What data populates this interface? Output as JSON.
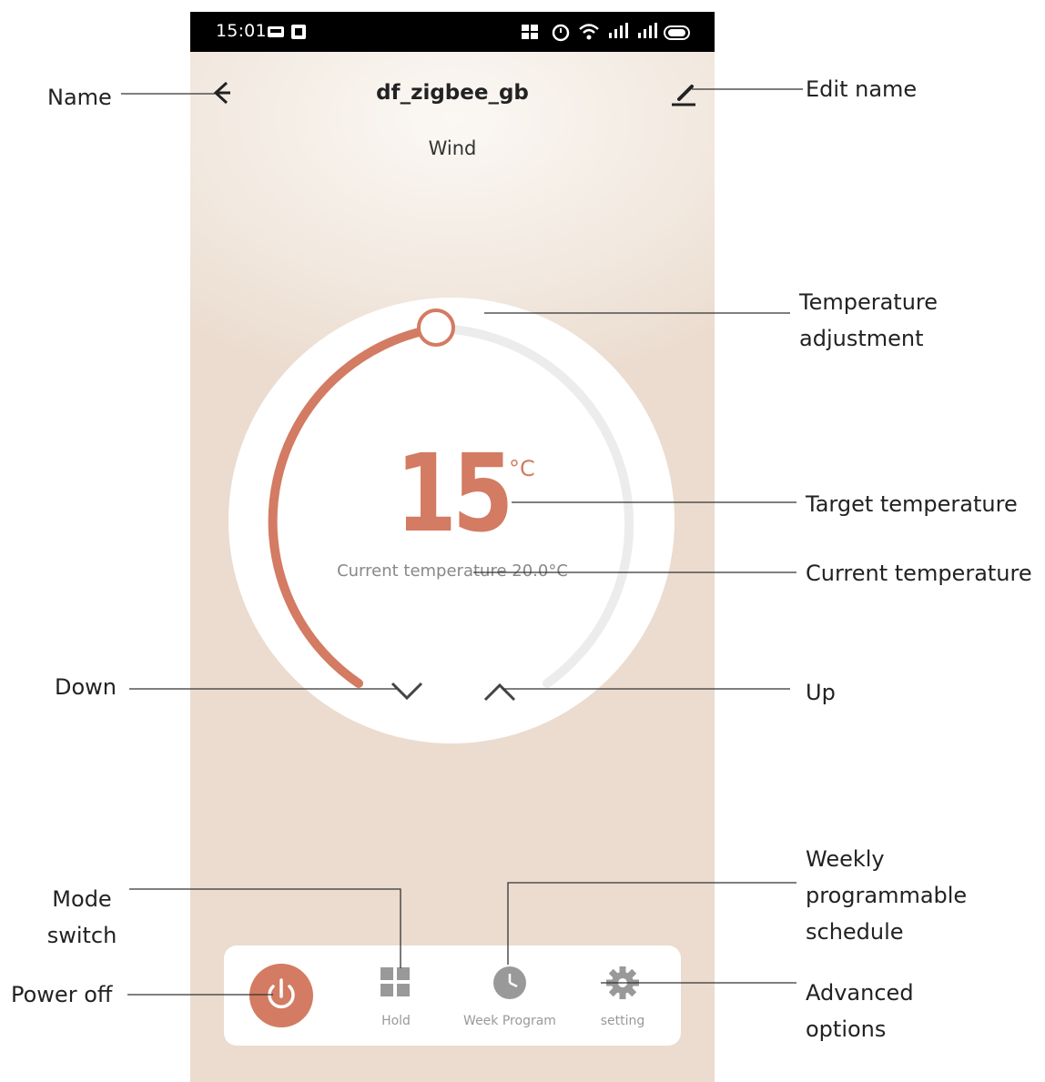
{
  "status_bar": {
    "time": "15:01",
    "right_icons": "⏰ 📶"
  },
  "header": {
    "title": "df_zigbee_gb",
    "subtitle": "Wind"
  },
  "thermostat": {
    "target_temperature": "15",
    "unit": "°C",
    "current_temperature_label": "Current temperature",
    "current_temperature_value": "20.0°C"
  },
  "bottom_bar": {
    "hold_label": "Hold",
    "week_program_label": "Week Program",
    "setting_label": "setting"
  },
  "annotations": {
    "name": "Name",
    "edit_name": "Edit name",
    "temperature_adjustment_1": "Temperature",
    "temperature_adjustment_2": "adjustment",
    "target_temperature": "Target temperature",
    "current_temperature": "Current temperature",
    "down": "Down",
    "up": "Up",
    "mode_switch_1": "Mode",
    "mode_switch_2": "switch",
    "power_off": "Power off",
    "weekly_1": "Weekly",
    "weekly_2": "programmable",
    "weekly_3": "schedule",
    "advanced_1": "Advanced",
    "advanced_2": "options"
  },
  "colors": {
    "accent": "#d37b63",
    "track": "#ececec",
    "background": "#f2e9e0"
  }
}
